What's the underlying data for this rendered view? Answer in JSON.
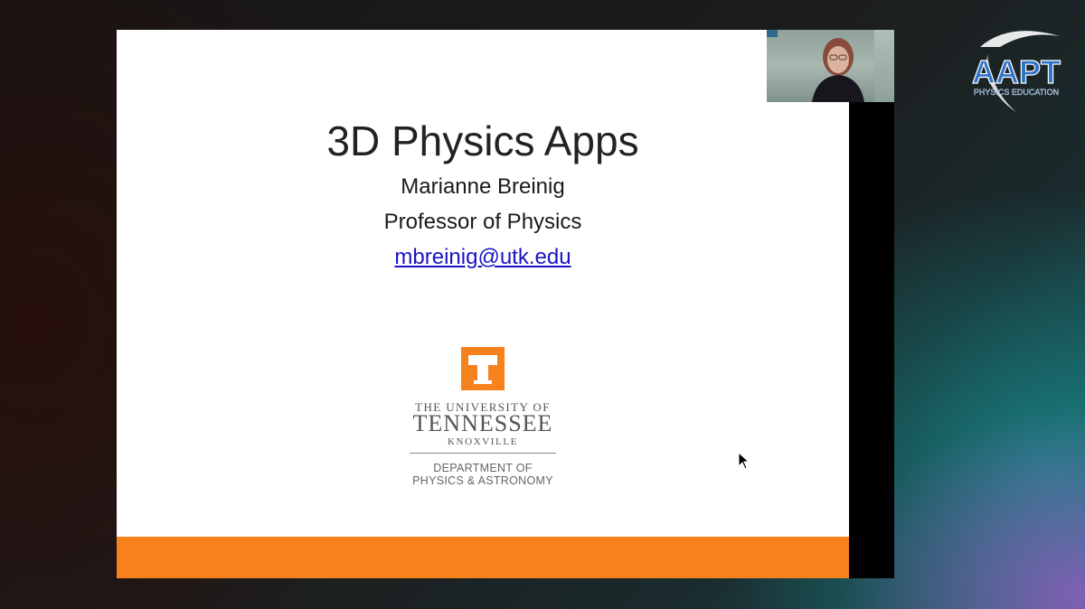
{
  "slide": {
    "title": "3D Physics Apps",
    "author_name": "Marianne Breinig",
    "author_role": "Professor of Physics",
    "author_email": "mbreinig@utk.edu"
  },
  "logo": {
    "letter": "T",
    "line1": "THE UNIVERSITY OF",
    "line2": "TENNESSEE",
    "line3": "KNOXVILLE",
    "dept_line1": "DEPARTMENT OF",
    "dept_line2": "PHYSICS & ASTRONOMY"
  },
  "watermark": {
    "brand": "AAPT",
    "tagline": "PHYSICS EDUCATION"
  },
  "colors": {
    "ut_orange": "#f7811d",
    "link_blue": "#1a13c4",
    "aapt_blue": "#2e74c9"
  }
}
